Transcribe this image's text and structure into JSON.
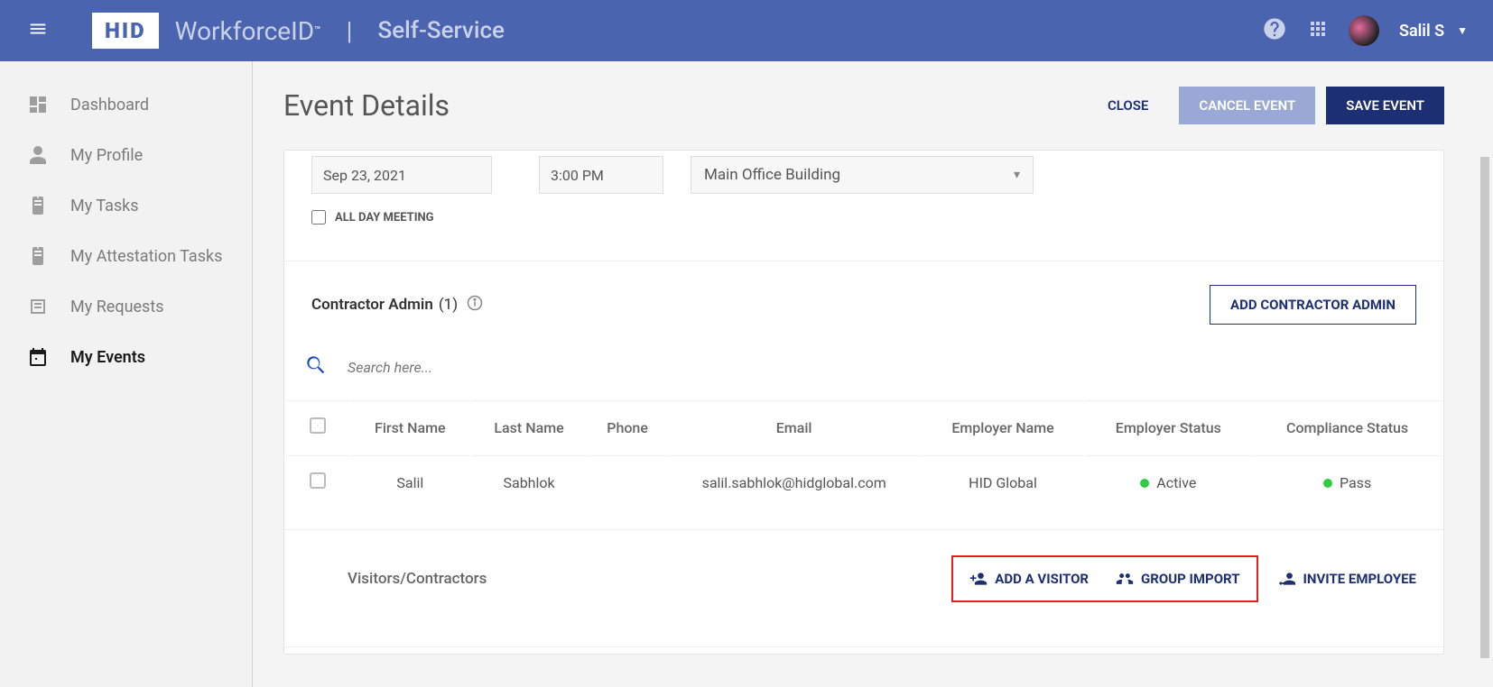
{
  "header": {
    "brand_text": "WorkforceID",
    "tm": "™",
    "app_text": "Self-Service",
    "user_name": "Salil S"
  },
  "sidebar": {
    "items": [
      {
        "label": "Dashboard"
      },
      {
        "label": "My Profile"
      },
      {
        "label": "My Tasks"
      },
      {
        "label": "My Attestation Tasks"
      },
      {
        "label": "My Requests"
      },
      {
        "label": "My Events"
      }
    ]
  },
  "page": {
    "title": "Event Details",
    "close": "CLOSE",
    "cancel": "CANCEL EVENT",
    "save": "SAVE EVENT"
  },
  "event": {
    "date": "Sep 23, 2021",
    "time": "3:00 PM",
    "location": "Main Office Building",
    "allday_label": "ALL DAY MEETING"
  },
  "contractor": {
    "section_title": "Contractor Admin",
    "count": "(1)",
    "add_label": "ADD CONTRACTOR ADMIN",
    "search_placeholder": "Search here...",
    "columns": {
      "first_name": "First Name",
      "last_name": "Last Name",
      "phone": "Phone",
      "email": "Email",
      "employer_name": "Employer Name",
      "employer_status": "Employer Status",
      "compliance_status": "Compliance Status"
    },
    "row": {
      "first_name": "Salil",
      "last_name": "Sabhlok",
      "phone": "",
      "email": "salil.sabhlok@hidglobal.com",
      "employer_name": "HID Global",
      "employer_status": "Active",
      "compliance_status": "Pass"
    }
  },
  "visitors": {
    "title": "Visitors/Contractors",
    "add_visitor": "ADD A VISITOR",
    "group_import": "GROUP IMPORT",
    "invite_employee": "INVITE EMPLOYEE"
  }
}
